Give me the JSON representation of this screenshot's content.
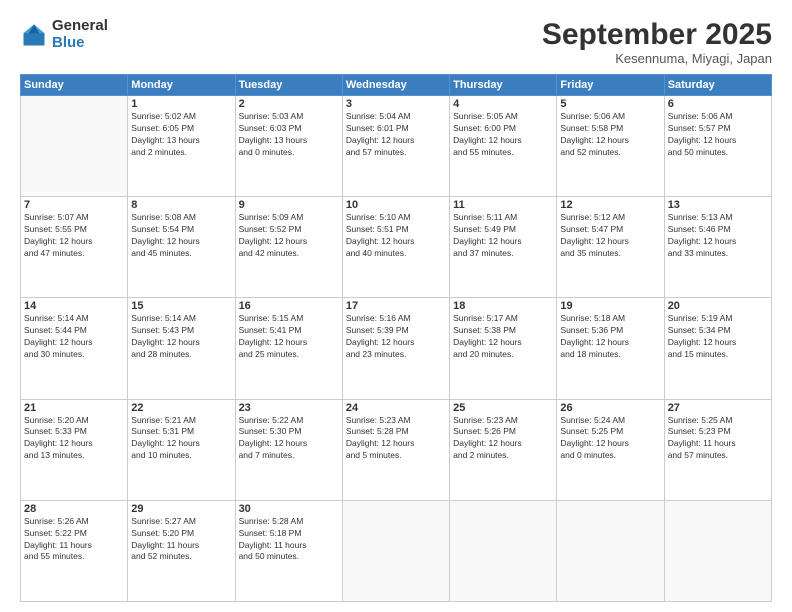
{
  "logo": {
    "general": "General",
    "blue": "Blue"
  },
  "header": {
    "title": "September 2025",
    "location": "Kesennuma, Miyagi, Japan"
  },
  "days": [
    "Sunday",
    "Monday",
    "Tuesday",
    "Wednesday",
    "Thursday",
    "Friday",
    "Saturday"
  ],
  "weeks": [
    [
      {
        "num": "",
        "lines": []
      },
      {
        "num": "1",
        "lines": [
          "Sunrise: 5:02 AM",
          "Sunset: 6:05 PM",
          "Daylight: 13 hours",
          "and 2 minutes."
        ]
      },
      {
        "num": "2",
        "lines": [
          "Sunrise: 5:03 AM",
          "Sunset: 6:03 PM",
          "Daylight: 13 hours",
          "and 0 minutes."
        ]
      },
      {
        "num": "3",
        "lines": [
          "Sunrise: 5:04 AM",
          "Sunset: 6:01 PM",
          "Daylight: 12 hours",
          "and 57 minutes."
        ]
      },
      {
        "num": "4",
        "lines": [
          "Sunrise: 5:05 AM",
          "Sunset: 6:00 PM",
          "Daylight: 12 hours",
          "and 55 minutes."
        ]
      },
      {
        "num": "5",
        "lines": [
          "Sunrise: 5:06 AM",
          "Sunset: 5:58 PM",
          "Daylight: 12 hours",
          "and 52 minutes."
        ]
      },
      {
        "num": "6",
        "lines": [
          "Sunrise: 5:06 AM",
          "Sunset: 5:57 PM",
          "Daylight: 12 hours",
          "and 50 minutes."
        ]
      }
    ],
    [
      {
        "num": "7",
        "lines": [
          "Sunrise: 5:07 AM",
          "Sunset: 5:55 PM",
          "Daylight: 12 hours",
          "and 47 minutes."
        ]
      },
      {
        "num": "8",
        "lines": [
          "Sunrise: 5:08 AM",
          "Sunset: 5:54 PM",
          "Daylight: 12 hours",
          "and 45 minutes."
        ]
      },
      {
        "num": "9",
        "lines": [
          "Sunrise: 5:09 AM",
          "Sunset: 5:52 PM",
          "Daylight: 12 hours",
          "and 42 minutes."
        ]
      },
      {
        "num": "10",
        "lines": [
          "Sunrise: 5:10 AM",
          "Sunset: 5:51 PM",
          "Daylight: 12 hours",
          "and 40 minutes."
        ]
      },
      {
        "num": "11",
        "lines": [
          "Sunrise: 5:11 AM",
          "Sunset: 5:49 PM",
          "Daylight: 12 hours",
          "and 37 minutes."
        ]
      },
      {
        "num": "12",
        "lines": [
          "Sunrise: 5:12 AM",
          "Sunset: 5:47 PM",
          "Daylight: 12 hours",
          "and 35 minutes."
        ]
      },
      {
        "num": "13",
        "lines": [
          "Sunrise: 5:13 AM",
          "Sunset: 5:46 PM",
          "Daylight: 12 hours",
          "and 33 minutes."
        ]
      }
    ],
    [
      {
        "num": "14",
        "lines": [
          "Sunrise: 5:14 AM",
          "Sunset: 5:44 PM",
          "Daylight: 12 hours",
          "and 30 minutes."
        ]
      },
      {
        "num": "15",
        "lines": [
          "Sunrise: 5:14 AM",
          "Sunset: 5:43 PM",
          "Daylight: 12 hours",
          "and 28 minutes."
        ]
      },
      {
        "num": "16",
        "lines": [
          "Sunrise: 5:15 AM",
          "Sunset: 5:41 PM",
          "Daylight: 12 hours",
          "and 25 minutes."
        ]
      },
      {
        "num": "17",
        "lines": [
          "Sunrise: 5:16 AM",
          "Sunset: 5:39 PM",
          "Daylight: 12 hours",
          "and 23 minutes."
        ]
      },
      {
        "num": "18",
        "lines": [
          "Sunrise: 5:17 AM",
          "Sunset: 5:38 PM",
          "Daylight: 12 hours",
          "and 20 minutes."
        ]
      },
      {
        "num": "19",
        "lines": [
          "Sunrise: 5:18 AM",
          "Sunset: 5:36 PM",
          "Daylight: 12 hours",
          "and 18 minutes."
        ]
      },
      {
        "num": "20",
        "lines": [
          "Sunrise: 5:19 AM",
          "Sunset: 5:34 PM",
          "Daylight: 12 hours",
          "and 15 minutes."
        ]
      }
    ],
    [
      {
        "num": "21",
        "lines": [
          "Sunrise: 5:20 AM",
          "Sunset: 5:33 PM",
          "Daylight: 12 hours",
          "and 13 minutes."
        ]
      },
      {
        "num": "22",
        "lines": [
          "Sunrise: 5:21 AM",
          "Sunset: 5:31 PM",
          "Daylight: 12 hours",
          "and 10 minutes."
        ]
      },
      {
        "num": "23",
        "lines": [
          "Sunrise: 5:22 AM",
          "Sunset: 5:30 PM",
          "Daylight: 12 hours",
          "and 7 minutes."
        ]
      },
      {
        "num": "24",
        "lines": [
          "Sunrise: 5:23 AM",
          "Sunset: 5:28 PM",
          "Daylight: 12 hours",
          "and 5 minutes."
        ]
      },
      {
        "num": "25",
        "lines": [
          "Sunrise: 5:23 AM",
          "Sunset: 5:26 PM",
          "Daylight: 12 hours",
          "and 2 minutes."
        ]
      },
      {
        "num": "26",
        "lines": [
          "Sunrise: 5:24 AM",
          "Sunset: 5:25 PM",
          "Daylight: 12 hours",
          "and 0 minutes."
        ]
      },
      {
        "num": "27",
        "lines": [
          "Sunrise: 5:25 AM",
          "Sunset: 5:23 PM",
          "Daylight: 11 hours",
          "and 57 minutes."
        ]
      }
    ],
    [
      {
        "num": "28",
        "lines": [
          "Sunrise: 5:26 AM",
          "Sunset: 5:22 PM",
          "Daylight: 11 hours",
          "and 55 minutes."
        ]
      },
      {
        "num": "29",
        "lines": [
          "Sunrise: 5:27 AM",
          "Sunset: 5:20 PM",
          "Daylight: 11 hours",
          "and 52 minutes."
        ]
      },
      {
        "num": "30",
        "lines": [
          "Sunrise: 5:28 AM",
          "Sunset: 5:18 PM",
          "Daylight: 11 hours",
          "and 50 minutes."
        ]
      },
      {
        "num": "",
        "lines": []
      },
      {
        "num": "",
        "lines": []
      },
      {
        "num": "",
        "lines": []
      },
      {
        "num": "",
        "lines": []
      }
    ]
  ]
}
